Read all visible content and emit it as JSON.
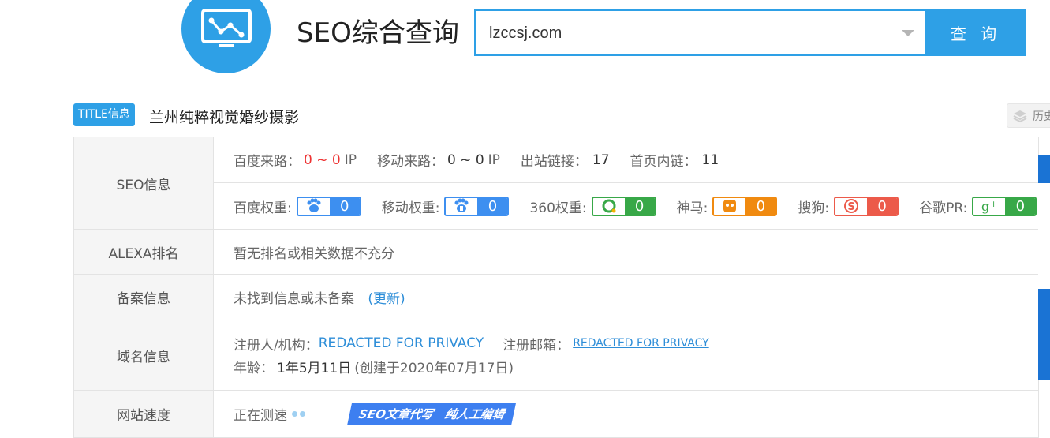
{
  "header": {
    "brand_title": "SEO综合查询",
    "search_value": "lzccsj.com",
    "search_button": "查 询"
  },
  "title_row": {
    "badge": "TITLE信息",
    "site_title": "兰州纯粹视觉婚纱摄影",
    "history_label": "历史"
  },
  "seo_info": {
    "label": "SEO信息",
    "baidu_traffic_label": "百度来路：",
    "baidu_traffic_value": "0 ~ 0",
    "baidu_traffic_unit": "IP",
    "mobile_traffic_label": "移动来路：",
    "mobile_traffic_value": "0 ~ 0",
    "mobile_traffic_unit": "IP",
    "outbound_label": "出站链接：",
    "outbound_value": "17",
    "internal_label": "首页内链：",
    "internal_value": "11",
    "weights": [
      {
        "label": "百度权重:",
        "value": "0",
        "icon": "baidu-paw-icon",
        "color": "#3d8ff0"
      },
      {
        "label": "移动权重:",
        "value": "0",
        "icon": "mobile-baidu-icon",
        "color": "#3d8ff0"
      },
      {
        "label": "360权重:",
        "value": "0",
        "icon": "360-icon",
        "color": "#38a848"
      },
      {
        "label": "神马:",
        "value": "0",
        "icon": "shenma-icon",
        "color": "#f08a10"
      },
      {
        "label": "搜狗:",
        "value": "0",
        "icon": "sogou-icon",
        "color": "#ec5a4a"
      },
      {
        "label": "谷歌PR:",
        "value": "0",
        "icon": "google-plus-icon",
        "color": "#38a848"
      }
    ]
  },
  "alexa": {
    "label": "ALEXA排名",
    "value": "暂无排名或相关数据不充分"
  },
  "icp": {
    "label": "备案信息",
    "value": "未找到信息或未备案",
    "update_link": "(更新)"
  },
  "domain": {
    "label": "域名信息",
    "registrant_label": "注册人/机构：",
    "registrant_value": "REDACTED FOR PRIVACY",
    "email_label": "注册邮箱：",
    "email_value": "REDACTED FOR PRIVACY",
    "age_label": "年龄：",
    "age_value": "1年5月11日",
    "created": "(创建于2020年07月17日)"
  },
  "speed": {
    "label": "网站速度",
    "status": "正在测速",
    "banner_part1": "SEO文章代写",
    "banner_part2": "纯人工编辑"
  }
}
